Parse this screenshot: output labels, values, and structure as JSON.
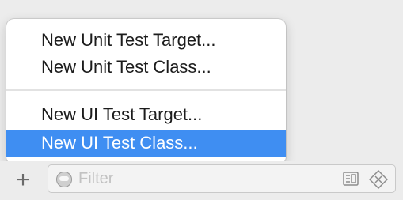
{
  "menu": {
    "items": [
      {
        "label": "New Unit Test Target...",
        "selected": false
      },
      {
        "label": "New Unit Test Class...",
        "selected": false
      },
      {
        "label": "New UI Test Target...",
        "selected": false
      },
      {
        "label": "New UI Test Class...",
        "selected": true
      }
    ],
    "highlight_color": "#3f8ef2"
  },
  "toolbar": {
    "add_label": "+",
    "filter": {
      "placeholder": "Filter",
      "value": "",
      "icons": [
        "filter-circle-icon",
        "document-filter-icon",
        "clear-filter-icon"
      ]
    }
  }
}
